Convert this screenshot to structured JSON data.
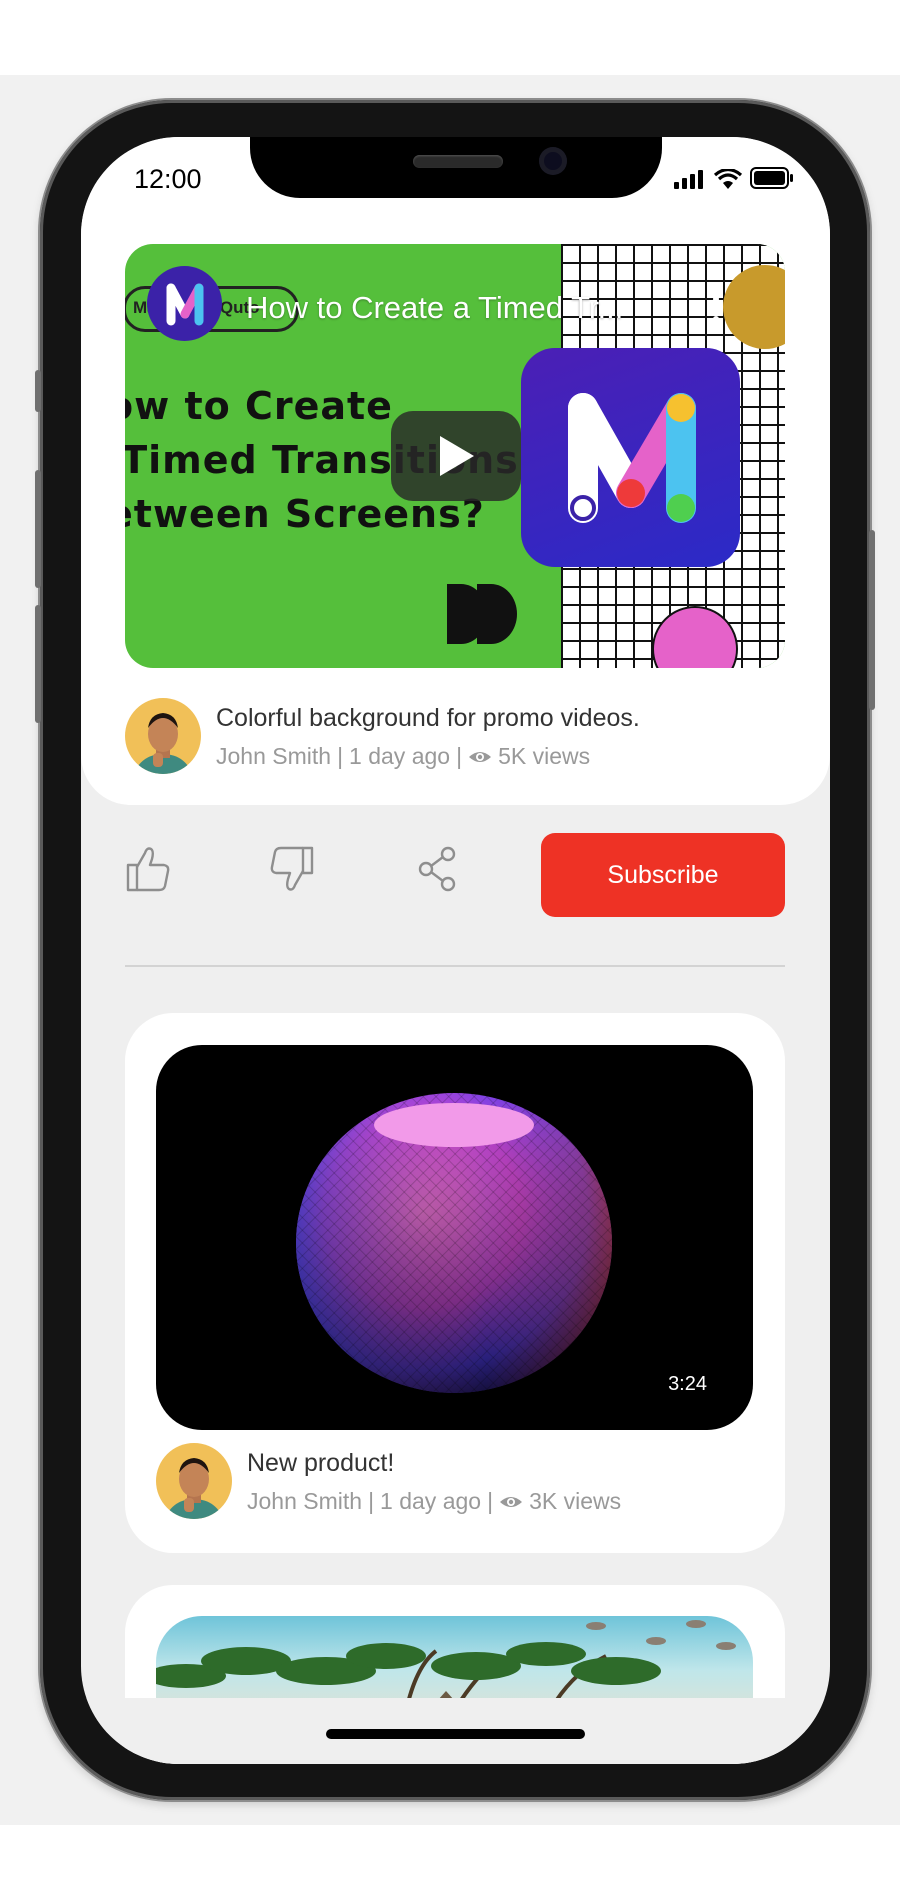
{
  "status_bar": {
    "time": "12:00"
  },
  "featured_video": {
    "overlay_title": "How to Create a Timed Tr...",
    "badge_text": "Made with Quto",
    "thumbnail_lines": [
      "ow to Create",
      " Timed Transitions",
      "etween Screens?"
    ],
    "title": "Colorful background for promo videos.",
    "author": "John Smith",
    "posted": "1 day ago",
    "views": "5K views"
  },
  "actions": {
    "like_icon": "thumbs-up-icon",
    "dislike_icon": "thumbs-down-icon",
    "share_icon": "share-icon",
    "subscribe_label": "Subscribe"
  },
  "videos": [
    {
      "title": "New product!",
      "author": "John Smith",
      "posted": "1 day ago",
      "views": "3K views",
      "duration": "3:24"
    }
  ],
  "colors": {
    "accent": "#ee3225",
    "thumbnail_green": "#55bf3b",
    "logo_purple": "#3b22a8"
  }
}
